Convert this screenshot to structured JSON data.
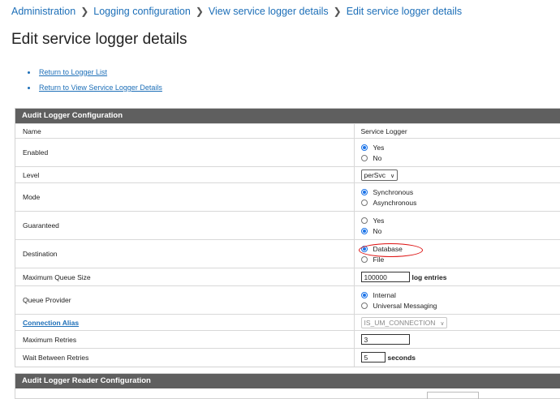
{
  "breadcrumb": [
    "Administration",
    "Logging configuration",
    "View service logger details",
    "Edit service logger details"
  ],
  "page_title": "Edit service logger details",
  "links": [
    "Return to Logger List",
    "Return to View Service Logger Details"
  ],
  "panel": {
    "header": "Audit Logger Configuration",
    "col_name": "Name",
    "col_value": "Service Logger",
    "enabled": {
      "label": "Enabled",
      "opt1": "Yes",
      "opt2": "No",
      "selected": "Yes"
    },
    "level": {
      "label": "Level",
      "value": "perSvc"
    },
    "mode": {
      "label": "Mode",
      "opt1": "Synchronous",
      "opt2": "Asynchronous",
      "selected": "Synchronous"
    },
    "guaranteed": {
      "label": "Guaranteed",
      "opt1": "Yes",
      "opt2": "No",
      "selected": "No"
    },
    "destination": {
      "label": "Destination",
      "opt1": "Database",
      "opt2": "File",
      "selected": "Database"
    },
    "max_queue": {
      "label": "Maximum Queue Size",
      "value": "100000",
      "suffix": "log entries"
    },
    "queue_provider": {
      "label": "Queue Provider",
      "opt1": "Internal",
      "opt2": "Universal Messaging",
      "selected": "Internal"
    },
    "connection_alias": {
      "label": "Connection Alias",
      "value": "IS_UM_CONNECTION"
    },
    "max_retries": {
      "label": "Maximum Retries",
      "value": "3"
    },
    "wait_retries": {
      "label": "Wait Between Retries",
      "value": "5",
      "suffix": "seconds"
    }
  },
  "panel2": {
    "header": "Audit Logger Reader Configuration"
  },
  "colors": {
    "link": "#1d6fb8",
    "header_bg": "#5f5f5f",
    "radio_on": "#1a73e8",
    "annotation": "#dd1111"
  }
}
